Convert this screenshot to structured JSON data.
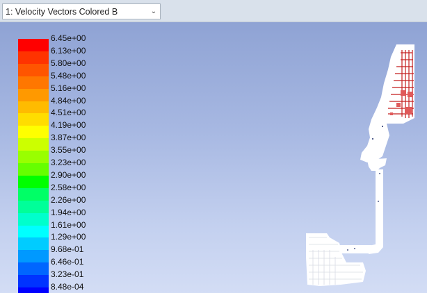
{
  "toolbar": {
    "window_selector_label": "1: Velocity Vectors Colored B",
    "chevron_icon": "chevron-down-icon"
  },
  "legend": {
    "labels": [
      "6.45e+00",
      "6.13e+00",
      "5.80e+00",
      "5.48e+00",
      "5.16e+00",
      "4.84e+00",
      "4.51e+00",
      "4.19e+00",
      "3.87e+00",
      "3.55e+00",
      "3.23e+00",
      "2.90e+00",
      "2.58e+00",
      "2.26e+00",
      "1.94e+00",
      "1.61e+00",
      "1.29e+00",
      "9.68e-01",
      "6.46e-01",
      "3.23e-01",
      "8.48e-04"
    ],
    "colors": [
      "#ff0000",
      "#ff3300",
      "#ff5500",
      "#ff7700",
      "#ff9900",
      "#ffbb00",
      "#ffdd00",
      "#ffff00",
      "#ccff00",
      "#99ff00",
      "#66ff00",
      "#00ff00",
      "#00ff66",
      "#00ff99",
      "#00ffcc",
      "#00ffff",
      "#00ccff",
      "#0099ff",
      "#0066ff",
      "#0033ff",
      "#0000ff"
    ]
  },
  "colors": {
    "viewport_top": "#8fa3d4",
    "viewport_bottom": "#d3ddf5",
    "geometry": "#ffffff",
    "high_velocity": "#cc2222"
  }
}
